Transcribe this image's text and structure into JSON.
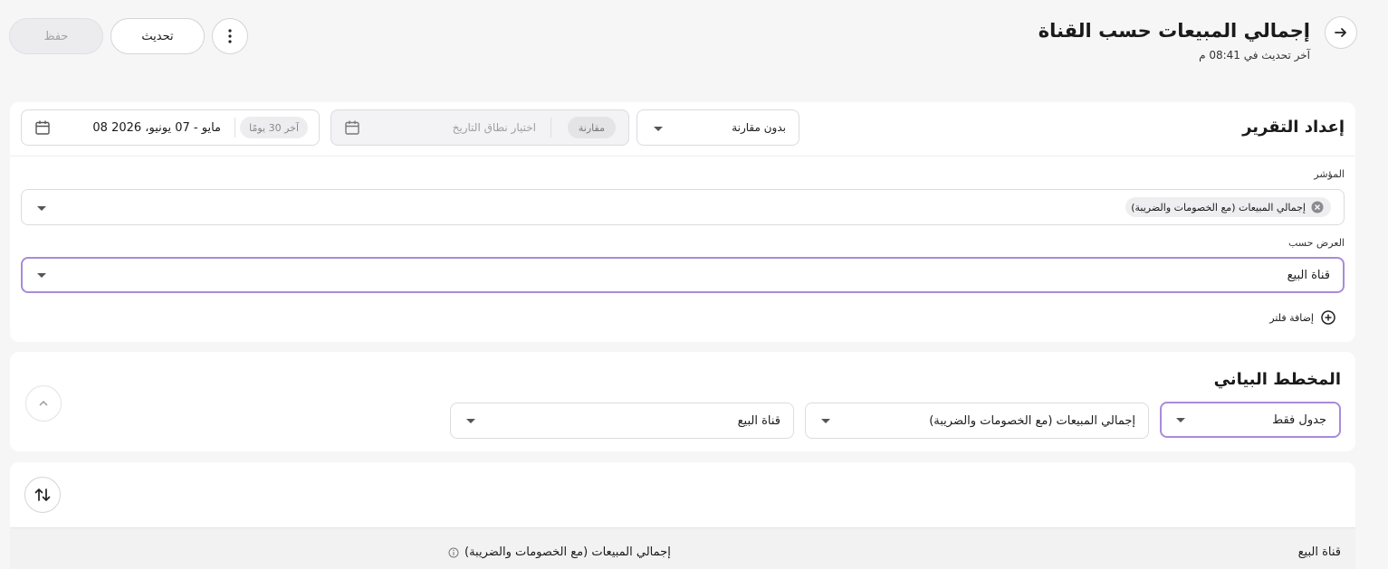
{
  "header": {
    "title": "إجمالي المبيعات حسب القناة",
    "subtitle": "آخر تحديث في 08:41 م",
    "refresh_label": "تحديث",
    "save_label": "حفظ"
  },
  "report_setup": {
    "title": "إعداد التقرير",
    "date_range": "08 مايو - 07 يونيو، 2026",
    "date_preset": "آخر 30 يومًا",
    "compare_placeholder": "اختيار نطاق التاريخ",
    "compare_chip": "مقارنة",
    "compare_select": "بدون مقارنة",
    "metric_label": "المؤشر",
    "metric_tag": "إجمالي المبيعات (مع الخصومات والضريبة)",
    "group_label": "العرض حسب",
    "group_value": "قناة البيع",
    "add_filter": "إضافة فلتر"
  },
  "chart_section": {
    "title": "المخطط البياني",
    "type_value": "جدول فقط",
    "metric_value": "إجمالي المبيعات (مع الخصومات والضريبة)",
    "dimension_value": "قناة البيع"
  },
  "table": {
    "col_channel": "قناة البيع",
    "col_sales": "إجمالي المبيعات (مع الخصومات والضريبة)"
  },
  "colors": {
    "accent": "#a98bd8",
    "background": "#f6f6f7"
  }
}
